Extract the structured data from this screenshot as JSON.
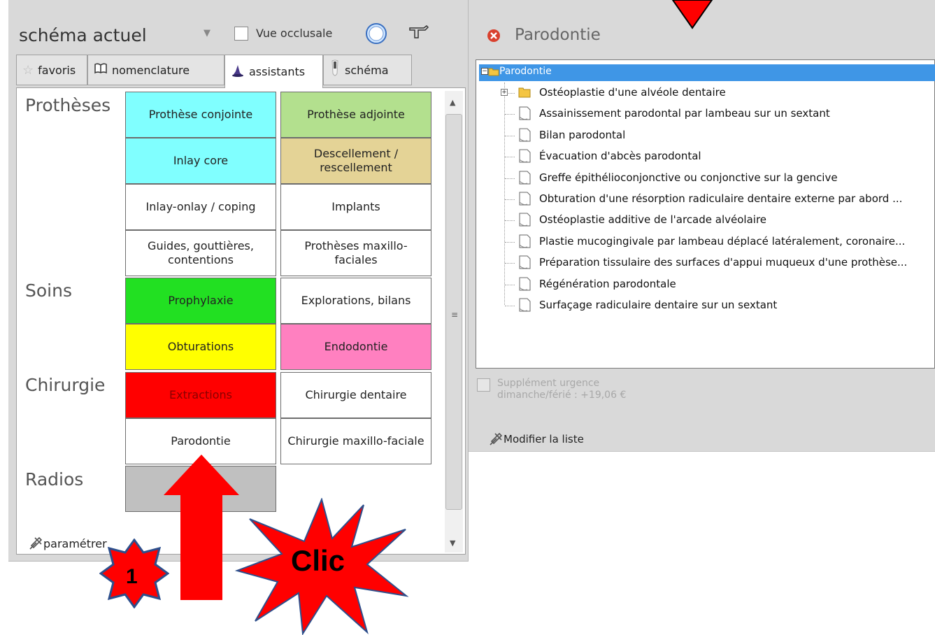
{
  "toolbar": {
    "schema_value": "schéma actuel",
    "vue_occlusale_label": "Vue occlusale"
  },
  "tabs": [
    {
      "label": "favoris",
      "icon": "star-icon"
    },
    {
      "label": "nomenclature",
      "icon": "book-icon"
    },
    {
      "label": "assistants",
      "icon": "wizard-hat-icon",
      "active": true
    },
    {
      "label": "schéma",
      "icon": "tooth-icon"
    }
  ],
  "sections": {
    "protheses": "Prothèses",
    "soins": "Soins",
    "chirurgie": "Chirurgie",
    "radios": "Radios"
  },
  "cells": [
    {
      "label": "Prothèse conjointe",
      "color": "#80ffff"
    },
    {
      "label": "Prothèse adjointe",
      "color": "#b3e08e"
    },
    {
      "label": "Inlay core",
      "color": "#80ffff"
    },
    {
      "label": "Descellement / rescellement",
      "color": "#e4d396"
    },
    {
      "label": "Inlay-onlay / coping",
      "color": "#ffffff"
    },
    {
      "label": "Implants",
      "color": "#ffffff"
    },
    {
      "label": "Guides, gouttières, contentions",
      "color": "#ffffff"
    },
    {
      "label": "Prothèses maxillo-faciales",
      "color": "#ffffff"
    },
    {
      "label": "Prophylaxie",
      "color": "#22e022"
    },
    {
      "label": "Explorations, bilans",
      "color": "#ffffff"
    },
    {
      "label": "Obturations",
      "color": "#ffff00"
    },
    {
      "label": "Endodontie",
      "color": "#ff80c0"
    },
    {
      "label": "Extractions",
      "color": "#ff0000"
    },
    {
      "label": "Chirurgie dentaire",
      "color": "#ffffff"
    },
    {
      "label": "Parodontie",
      "color": "#ffffff"
    },
    {
      "label": "Chirurgie maxillo-faciale",
      "color": "#ffffff"
    },
    {
      "label": "",
      "color": "#c0c0c0"
    }
  ],
  "parametrer_label": "paramétrer",
  "right": {
    "title": "Parodontie",
    "tree_root": "Parodontie",
    "tree_items": [
      "Ostéoplastie d'une alvéole dentaire",
      "Assainissement parodontal par lambeau sur un sextant",
      "Bilan parodontal",
      "Évacuation d'abcès parodontal",
      "Greffe épithélioconjonctive ou conjonctive sur la gencive",
      "Obturation d'une résorption radiculaire dentaire externe par abord ...",
      "Ostéoplastie additive de l'arcade alvéolaire",
      "Plastie mucogingivale par lambeau déplacé latéralement, coronaire...",
      "Préparation tissulaire des surfaces d'appui muqueux d'une prothèse...",
      "Régénération parodontale",
      "Surfaçage radiculaire dentaire sur un sextant"
    ],
    "urgence_line1": "Supplément urgence",
    "urgence_line2": "dimanche/férié : +19,06 €",
    "modify_label": "Modifier la liste"
  },
  "annotations": {
    "step_number": "1",
    "clic_label": "Clic",
    "color": "#ff0000"
  }
}
